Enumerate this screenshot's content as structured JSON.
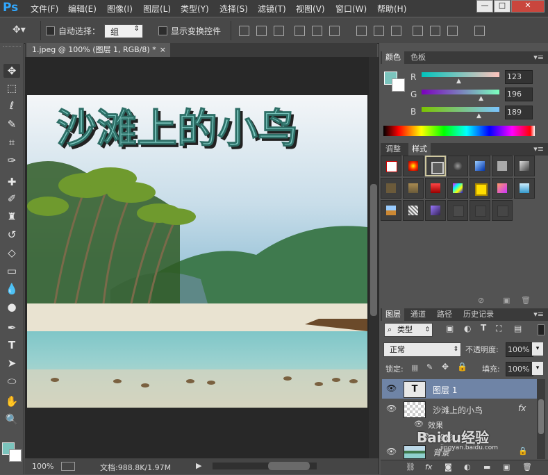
{
  "app": {
    "logo": "Ps"
  },
  "menu": [
    "文件(F)",
    "编辑(E)",
    "图像(I)",
    "图层(L)",
    "类型(Y)",
    "选择(S)",
    "滤镜(T)",
    "视图(V)",
    "窗口(W)",
    "帮助(H)"
  ],
  "window_controls": [
    "—",
    "□",
    "✕"
  ],
  "options": {
    "auto_select_label": "自动选择：",
    "auto_select_value": "组",
    "show_transform_label": "显示变换控件"
  },
  "document": {
    "tab_title": "1.jpeg @ 100% (图层 1, RGB/8) *",
    "tab_close": "×",
    "title_text": "沙滩上的小鸟",
    "zoom": "100%",
    "doc_size": "文档:988.8K/1.97M"
  },
  "color_panel": {
    "tabs": [
      "颜色",
      "色板"
    ],
    "r_label": "R",
    "r_value": "123",
    "g_label": "G",
    "g_value": "196",
    "b_label": "B",
    "b_value": "189",
    "r": 123,
    "g": 196,
    "b": 189,
    "fg_color": "#7bc4bd"
  },
  "styles_panel": {
    "tabs": [
      "调整",
      "样式"
    ]
  },
  "layers_panel": {
    "tabs": [
      "图层",
      "通道",
      "路径",
      "历史记录"
    ],
    "filter_kind": "类型",
    "blend_mode": "正常",
    "opacity_label": "不透明度:",
    "opacity_value": "100%",
    "lock_label": "锁定:",
    "fill_label": "填充:",
    "fill_value": "100%",
    "layers": [
      {
        "name": "图层 1",
        "type": "text"
      },
      {
        "name": "沙滩上的小鸟",
        "type": "pixel",
        "fx": "fx"
      },
      {
        "name": "效果",
        "type": "effect"
      },
      {
        "name": "投影",
        "type": "effect"
      },
      {
        "name": "背景",
        "type": "background"
      }
    ],
    "text_thumb_glyph": "T"
  },
  "watermark": {
    "text": "Baidu经验",
    "sub": "jingyan.baidu.com"
  },
  "icons": [
    "move-icon",
    "marquee-icon",
    "lasso-icon",
    "quick-select-icon",
    "crop-icon",
    "eyedropper-icon",
    "healing-icon",
    "brush-icon",
    "stamp-icon",
    "history-brush-icon",
    "eraser-icon",
    "gradient-icon",
    "blur-icon",
    "dodge-icon",
    "pen-icon",
    "type-icon",
    "path-select-icon",
    "shape-icon",
    "hand-icon",
    "zoom-icon"
  ]
}
